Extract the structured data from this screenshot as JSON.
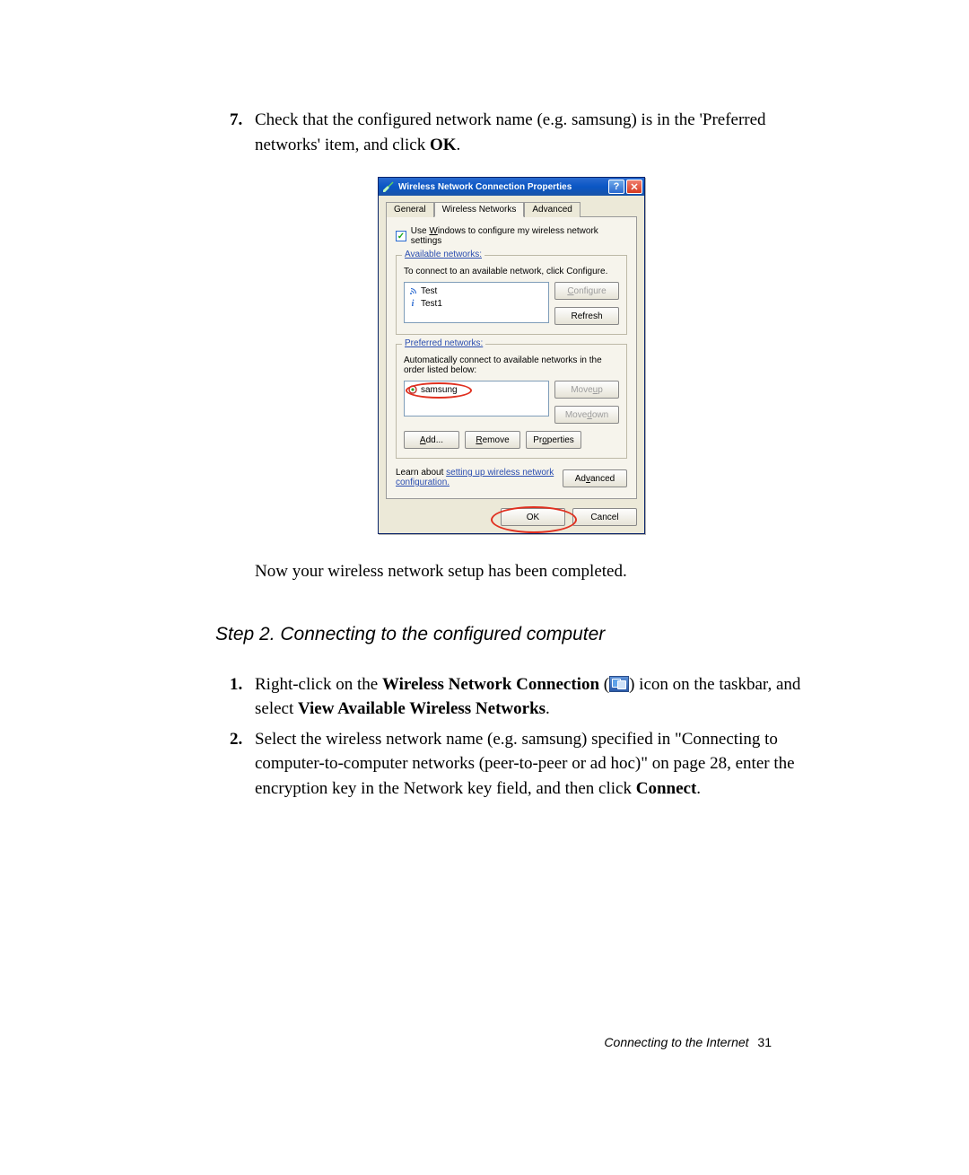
{
  "step7": {
    "num": "7.",
    "text_a": "Check that the configured network name (e.g. samsung) is in the 'Preferred networks' item, and click ",
    "text_ok": "OK",
    "text_b": "."
  },
  "dialog": {
    "title": "Wireless Network Connection Properties",
    "help_glyph": "?",
    "close_glyph": "✕",
    "tabs": {
      "general": "General",
      "wireless": "Wireless Networks",
      "advanced": "Advanced"
    },
    "use_windows_cbx": {
      "checked": true,
      "label_pre": "Use ",
      "label_u": "W",
      "label_post": "indows to configure my wireless network settings"
    },
    "available": {
      "legend_pre": "Available ",
      "legend_u": "n",
      "legend_post": "etworks:",
      "desc": "To connect to an available network, click Configure.",
      "items": [
        {
          "icon": "wifi",
          "name": "Test"
        },
        {
          "icon": "info",
          "name": "Test1"
        }
      ],
      "btn_configure": {
        "u": "C",
        "rest": "onfigure"
      },
      "btn_refresh": "Refresh"
    },
    "preferred": {
      "legend_pre": "",
      "legend_u": "P",
      "legend_post": "referred networks:",
      "desc": "Automatically connect to available networks in the order listed below:",
      "items": [
        {
          "icon": "pref",
          "name": "samsung"
        }
      ],
      "btn_moveup": {
        "pre": "Move ",
        "u": "u",
        "post": "p"
      },
      "btn_movedown": {
        "pre": "Move ",
        "u": "d",
        "post": "own"
      },
      "btn_add": {
        "u": "A",
        "rest": "dd..."
      },
      "btn_remove": {
        "u": "R",
        "rest": "emove"
      },
      "btn_props": {
        "pre": "Pr",
        "u": "o",
        "post": "perties"
      }
    },
    "learn": {
      "lead": "Learn about ",
      "link1": "setting up wireless network",
      "link2": "configuration.",
      "btn_advanced": {
        "pre": "Ad",
        "u": "v",
        "post": "anced"
      }
    },
    "footer": {
      "ok": "OK",
      "cancel": "Cancel"
    }
  },
  "followup": "Now your wireless network setup has been completed.",
  "step2_heading": "Step 2. Connecting to the configured computer",
  "item1": {
    "num": "1.",
    "a": "Right-click on the ",
    "b": "Wireless Network Connection",
    "c": " (",
    "d": ") icon on the taskbar, and select ",
    "e": "View Available Wireless Networks",
    "f": "."
  },
  "item2": {
    "num": "2.",
    "a": "Select the wireless network name (e.g. samsung) specified in \"Connecting to computer-to-computer networks (peer-to-peer or ad hoc)\" on page 28, enter the encryption key in the Network key field, and then click ",
    "b": "Connect",
    "c": "."
  },
  "page_footer": {
    "label": "Connecting to the Internet",
    "page": "31"
  }
}
